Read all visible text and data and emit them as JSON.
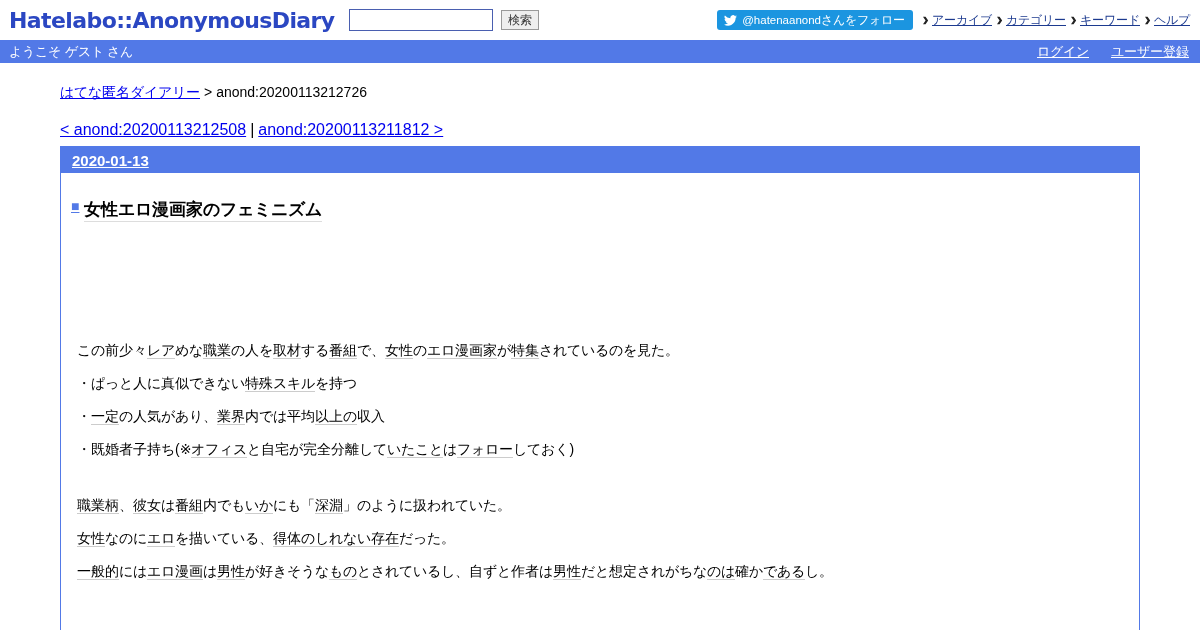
{
  "header": {
    "logo": "Hatelabo::AnonymousDiary",
    "search": {
      "button": "検索"
    },
    "follow_button": "@hatenaanondさんをフォロー",
    "links": [
      "アーカイブ",
      "カテゴリー",
      "キーワード",
      "ヘルプ"
    ]
  },
  "user_bar": {
    "welcome": "ようこそ ゲスト さん",
    "links": [
      "ログイン",
      "ユーザー登録"
    ]
  },
  "breadcrumb": {
    "home": "はてな匿名ダイアリー",
    "separator": ">",
    "current": "anond:20200113212726"
  },
  "pager": {
    "prev": "< anond:20200113212508",
    "separator": "|",
    "next": "anond:20200113211812 >"
  },
  "day": {
    "date": "2020-01-13",
    "title_mark": "■",
    "title": "女性エロ漫画家のフェミニズム",
    "paragraphs": [
      {
        "gap_before": false,
        "segments": [
          {
            "text": "この前少々",
            "keyword": false
          },
          {
            "text": "レア",
            "keyword": true
          },
          {
            "text": "めな",
            "keyword": false
          },
          {
            "text": "職業",
            "keyword": true
          },
          {
            "text": "の人を",
            "keyword": false
          },
          {
            "text": "取材",
            "keyword": true
          },
          {
            "text": "する",
            "keyword": false
          },
          {
            "text": "番組",
            "keyword": true
          },
          {
            "text": "で、",
            "keyword": false
          },
          {
            "text": "女性",
            "keyword": true
          },
          {
            "text": "の",
            "keyword": false
          },
          {
            "text": "エロ漫画家",
            "keyword": true
          },
          {
            "text": "が",
            "keyword": false
          },
          {
            "text": "特集",
            "keyword": true
          },
          {
            "text": "されているのを見た。",
            "keyword": false
          }
        ]
      },
      {
        "gap_before": false,
        "segments": [
          {
            "text": "・ぱっと人に真似できない",
            "keyword": false
          },
          {
            "text": "特殊スキル",
            "keyword": true
          },
          {
            "text": "を持つ",
            "keyword": false
          }
        ]
      },
      {
        "gap_before": false,
        "segments": [
          {
            "text": "・",
            "keyword": false
          },
          {
            "text": "一定",
            "keyword": true
          },
          {
            "text": "の人気があり、",
            "keyword": false
          },
          {
            "text": "業界",
            "keyword": true
          },
          {
            "text": "内では平均",
            "keyword": false
          },
          {
            "text": "以上の",
            "keyword": true
          },
          {
            "text": "収入",
            "keyword": false
          }
        ]
      },
      {
        "gap_before": false,
        "segments": [
          {
            "text": "・既婚者子持ち(※",
            "keyword": false
          },
          {
            "text": "オフィス",
            "keyword": true
          },
          {
            "text": "と自宅が完全分離して",
            "keyword": false
          },
          {
            "text": "いたこと",
            "keyword": true
          },
          {
            "text": "は",
            "keyword": false
          },
          {
            "text": "フォロー",
            "keyword": true
          },
          {
            "text": "しておく)",
            "keyword": false
          }
        ]
      },
      {
        "gap_before": true,
        "segments": [
          {
            "text": "職業柄",
            "keyword": true
          },
          {
            "text": "、",
            "keyword": false
          },
          {
            "text": "彼女",
            "keyword": true
          },
          {
            "text": "は",
            "keyword": false
          },
          {
            "text": "番組",
            "keyword": true
          },
          {
            "text": "内でも",
            "keyword": false
          },
          {
            "text": "いか",
            "keyword": true
          },
          {
            "text": "にも「",
            "keyword": false
          },
          {
            "text": "深淵",
            "keyword": true
          },
          {
            "text": "」のように扱われていた。",
            "keyword": false
          }
        ]
      },
      {
        "gap_before": false,
        "segments": [
          {
            "text": "女性",
            "keyword": true
          },
          {
            "text": "なのに",
            "keyword": false
          },
          {
            "text": "エロ",
            "keyword": true
          },
          {
            "text": "を描いている、",
            "keyword": false
          },
          {
            "text": "得体のしれない",
            "keyword": true
          },
          {
            "text": "存在",
            "keyword": true
          },
          {
            "text": "だった。",
            "keyword": false
          }
        ]
      },
      {
        "gap_before": false,
        "segments": [
          {
            "text": "一般的",
            "keyword": true
          },
          {
            "text": "には",
            "keyword": false
          },
          {
            "text": "エロ漫画",
            "keyword": true
          },
          {
            "text": "は",
            "keyword": false
          },
          {
            "text": "男性",
            "keyword": true
          },
          {
            "text": "が好きそうな",
            "keyword": false
          },
          {
            "text": "もの",
            "keyword": true
          },
          {
            "text": "とされているし、自ずと作者は",
            "keyword": false
          },
          {
            "text": "男性",
            "keyword": true
          },
          {
            "text": "だと想定されがちな",
            "keyword": false
          },
          {
            "text": "のは",
            "keyword": true
          },
          {
            "text": "確か",
            "keyword": false
          },
          {
            "text": "である",
            "keyword": true
          },
          {
            "text": "し。",
            "keyword": false
          }
        ]
      }
    ]
  }
}
